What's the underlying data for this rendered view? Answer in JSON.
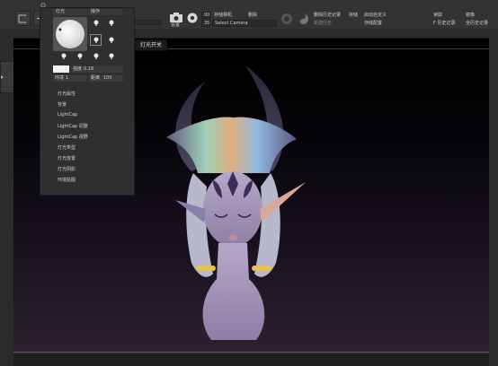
{
  "toolbar": {
    "camera_label": "存储相机",
    "delete_label": "删除",
    "camera_index": "00",
    "select_camera": "Select Camera",
    "index_35": "35",
    "delete_history_label": "删除历史记录",
    "save_label": "存储",
    "auto_define_label": "启动自定义",
    "read_label": "读取",
    "lens_label": "镜像",
    "new_history_label": "新建历史",
    "save_config_label": "存储配置",
    "history_label": "F 历史记录",
    "full_history_label": "全历史记录",
    "camera_icon_caption": "设置"
  },
  "light_panel": {
    "tab_light": "灯光",
    "tab_operate": "操作",
    "intensity_label": "强度",
    "intensity_value": "0.18",
    "distance_label": "距离",
    "distance_value": "100",
    "blur_label": "环境",
    "blur_value": "1",
    "menu": [
      "灯光属性",
      "背景",
      "LightCap",
      "LightCap 调整",
      "LightCap 视野",
      "灯光类型",
      "灯光放置",
      "灯光阴影",
      "环境贴图"
    ]
  },
  "tooltip": "灯光开关"
}
